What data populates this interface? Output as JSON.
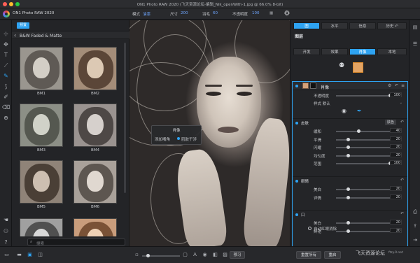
{
  "window": {
    "title": "ON1 Photo RAW 2020 (飞天资源论坛-编辑_Nik_openWith-1.jpg @ 66.0% 8-bit)",
    "traffic_colors": [
      "#ff5f57",
      "#febc2e",
      "#28c840"
    ]
  },
  "toolbar": {
    "app_name": "ON1 Photo RAW 2020",
    "mode_label": "模式",
    "mode_value": "油漆",
    "size_label": "尺寸",
    "size_value": "200",
    "feather_label": "羽毛",
    "feather_value": "60",
    "opacity_label": "不透明度",
    "opacity_value": "100"
  },
  "tools": {
    "icons": [
      "crop-icon",
      "transform-icon",
      "text-icon",
      "adjust-brush-icon",
      "masking-brush-icon",
      "perfect-brush-icon",
      "retouch-brush-icon",
      "eraser-icon",
      "zoom-icon"
    ],
    "glyphs": [
      "⊹",
      "✥",
      "T",
      "⟋",
      "✎",
      "⟆",
      "✐",
      "⌫",
      "🔍"
    ],
    "active_index": 4
  },
  "browser": {
    "tab_label": "预置",
    "category_title": "B&W Faded & Matte",
    "presets": [
      {
        "name": "BM1",
        "tone": "#9a968f"
      },
      {
        "name": "BM2",
        "tone": "#a48d79"
      },
      {
        "name": "BM3",
        "tone": "#8c8f86"
      },
      {
        "name": "BM4",
        "tone": "#9a9390"
      },
      {
        "name": "BM5",
        "tone": "#8f8378"
      },
      {
        "name": "BM6",
        "tone": "#a9a19a"
      },
      {
        "name": "",
        "tone": "#a0a0a0"
      },
      {
        "name": "",
        "tone": "#c99d7c"
      }
    ],
    "search_placeholder": "搜索"
  },
  "canvas": {
    "popup_title": "肖像",
    "popup_option_left": "添加嘴角",
    "popup_option_right": "肌肤干涉"
  },
  "top_tabs": [
    "图",
    "水平",
    "信息",
    "历史"
  ],
  "layers": {
    "title": "图层",
    "tabs": [
      "开发",
      "效果",
      "肖像",
      "本地"
    ],
    "active_tab": 2
  },
  "portrait": {
    "layer_name": "肖像",
    "opacity_label": "不透明度",
    "opacity_value": "100",
    "style_label": "样式",
    "style_value": "默认",
    "skin_section": "皮肤",
    "skin_tone_button": "肤色",
    "skin_rows": [
      {
        "label": "缓和",
        "value": "40",
        "fill": 0.4
      },
      {
        "label": "平滑",
        "value": "20",
        "fill": 0.2
      },
      {
        "label": "闪耀",
        "value": "20",
        "fill": 0.2
      },
      {
        "label": "均匀度",
        "value": "20",
        "fill": 0.2
      },
      {
        "label": "范围",
        "value": "100",
        "fill": 1.0
      }
    ],
    "eyes_section": "眼睛",
    "eyes_rows": [
      {
        "label": "美白",
        "value": "20",
        "fill": 0.2
      },
      {
        "label": "详情",
        "value": "20",
        "fill": 0.2
      }
    ],
    "auto_eye_label": "自动红眼消除",
    "mouth_section": "口",
    "mouth_rows": [
      {
        "label": "美白",
        "value": "20",
        "fill": 0.2
      },
      {
        "label": "鲜艳",
        "value": "20",
        "fill": 0.2
      }
    ]
  },
  "bottombar": {
    "preview_label": "预习",
    "reset_all_label": "重置所有",
    "reset_label": "重启"
  },
  "watermark": {
    "text": "飞天资源论坛",
    "sub": "ftzy.0.net"
  },
  "accent_color": "#2ea3f2"
}
